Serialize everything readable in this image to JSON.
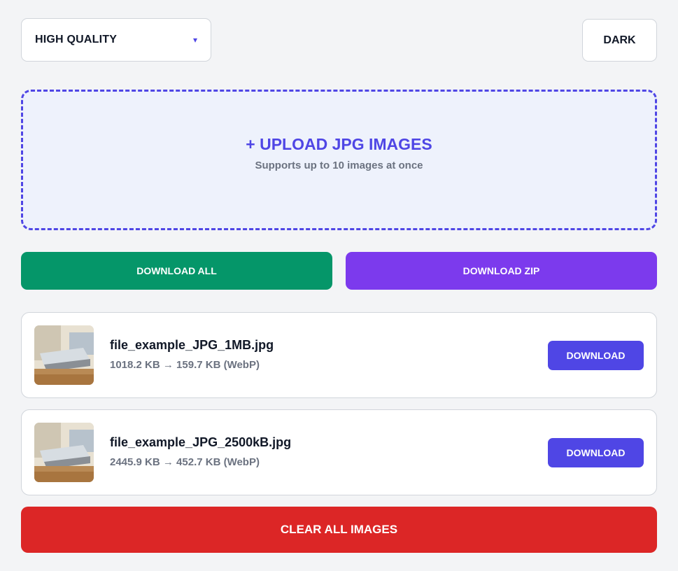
{
  "controls": {
    "quality_label": "HIGH QUALITY",
    "quality_caret": "▾",
    "theme_label": "DARK"
  },
  "upload": {
    "title": "+ UPLOAD JPG IMAGES",
    "subtitle": "Supports up to 10 images at once"
  },
  "actions": {
    "download_all": "DOWNLOAD ALL",
    "download_zip": "DOWNLOAD ZIP",
    "clear_all": "CLEAR ALL IMAGES"
  },
  "files": [
    {
      "name": "file_example_JPG_1MB.jpg",
      "size": "1018.2 KB → 159.7 KB (WebP)",
      "download_label": "DOWNLOAD",
      "thumbnail_icon": "laptop-photo-thumbnail"
    },
    {
      "name": "file_example_JPG_2500kB.jpg",
      "size": "2445.9 KB → 452.7 KB (WebP)",
      "download_label": "DOWNLOAD",
      "thumbnail_icon": "laptop-photo-thumbnail"
    }
  ],
  "colors": {
    "accent": "#4f46e5",
    "download_all": "#059669",
    "download_zip": "#7c3aed",
    "clear": "#dc2626",
    "background": "#f3f4f6"
  }
}
